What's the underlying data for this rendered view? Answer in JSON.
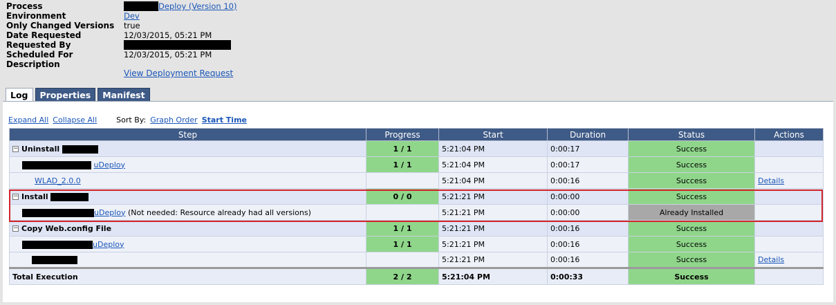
{
  "header": {
    "process_label": "Process",
    "process_link": "Deploy (Version 10)",
    "environment_label": "Environment",
    "environment_value": "Dev",
    "only_changed_label": "Only Changed Versions",
    "only_changed_value": "true",
    "date_requested_label": "Date Requested",
    "date_requested_value": "12/03/2015, 05:21 PM",
    "requested_by_label": "Requested By",
    "scheduled_for_label": "Scheduled For",
    "scheduled_for_value": "12/03/2015, 05:21 PM",
    "description_label": "Description",
    "view_request_link": "View Deployment Request"
  },
  "tabs": [
    {
      "label": "Log",
      "active": true
    },
    {
      "label": "Properties",
      "active": false
    },
    {
      "label": "Manifest",
      "active": false
    }
  ],
  "controls": {
    "expand_all": "Expand All",
    "collapse_all": "Collapse All",
    "sort_by": "Sort By:",
    "graph_order": "Graph Order",
    "start_time": "Start Time"
  },
  "table": {
    "headers": [
      "Step",
      "Progress",
      "Start",
      "Duration",
      "Status",
      "Actions"
    ],
    "rows": [
      {
        "step": "Uninstall",
        "progress": "1 / 1",
        "start": "5:21:04 PM",
        "duration": "0:00:17",
        "status": "Success",
        "actions": ""
      },
      {
        "step": "uDeploy",
        "progress": "1 / 1",
        "start": "5:21:04 PM",
        "duration": "0:00:17",
        "status": "Success",
        "actions": ""
      },
      {
        "step": "WLAD_2.0.0",
        "progress": "",
        "start": "5:21:04 PM",
        "duration": "0:00:16",
        "status": "Success",
        "actions": "Details"
      },
      {
        "step": "Install",
        "progress": "0 / 0",
        "start": "5:21:21 PM",
        "duration": "0:00:00",
        "status": "Success",
        "actions": ""
      },
      {
        "step": "uDeploy",
        "note": "(Not needed: Resource already had all versions)",
        "progress": "",
        "start": "5:21:21 PM",
        "duration": "0:00:00",
        "status": "Already Installed",
        "actions": ""
      },
      {
        "step": "Copy Web.config File",
        "progress": "1 / 1",
        "start": "5:21:21 PM",
        "duration": "0:00:16",
        "status": "Success",
        "actions": ""
      },
      {
        "step": "uDeploy",
        "progress": "1 / 1",
        "start": "5:21:21 PM",
        "duration": "0:00:16",
        "status": "Success",
        "actions": ""
      },
      {
        "step": "",
        "progress": "",
        "start": "5:21:21 PM",
        "duration": "0:00:16",
        "status": "Success",
        "actions": "Details"
      }
    ],
    "total": {
      "step": "Total Execution",
      "progress": "2 / 2",
      "start": "5:21:04 PM",
      "duration": "0:00:33",
      "status": "Success"
    }
  },
  "colors": {
    "header_blue": "#3e5a86",
    "success_green": "#8fd68a",
    "installed_gray": "#a8a8a8",
    "highlight_red": "#d4242b"
  }
}
